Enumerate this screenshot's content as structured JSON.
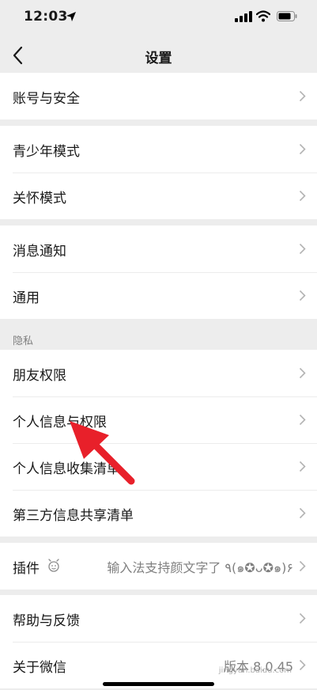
{
  "status_bar": {
    "time": "12:03"
  },
  "nav": {
    "title": "设置"
  },
  "section_privacy": "隐私",
  "groups": {
    "account": [
      "账号与安全"
    ],
    "modes": [
      "青少年模式",
      "关怀模式"
    ],
    "general": [
      "消息通知",
      "通用"
    ],
    "privacy": [
      "朋友权限",
      "个人信息与权限",
      "个人信息收集清单",
      "第三方信息共享清单"
    ],
    "plugin": {
      "label": "插件",
      "value": "输入法支持颜文字了 ٩(๑✪ᴗ✪๑)۶"
    },
    "about": {
      "help": "帮助与反馈",
      "about": "关于微信",
      "version": "版本 8.0.45"
    }
  },
  "watermark": "jingyan.baidu.com",
  "colors": {
    "background": "#ededed",
    "annotation_arrow": "#e8202a"
  },
  "icons": [
    "location-arrow-icon",
    "signal-icon",
    "wifi-icon",
    "battery-icon",
    "back-chevron-icon",
    "chevron-right-icon",
    "plugin-icon"
  ]
}
